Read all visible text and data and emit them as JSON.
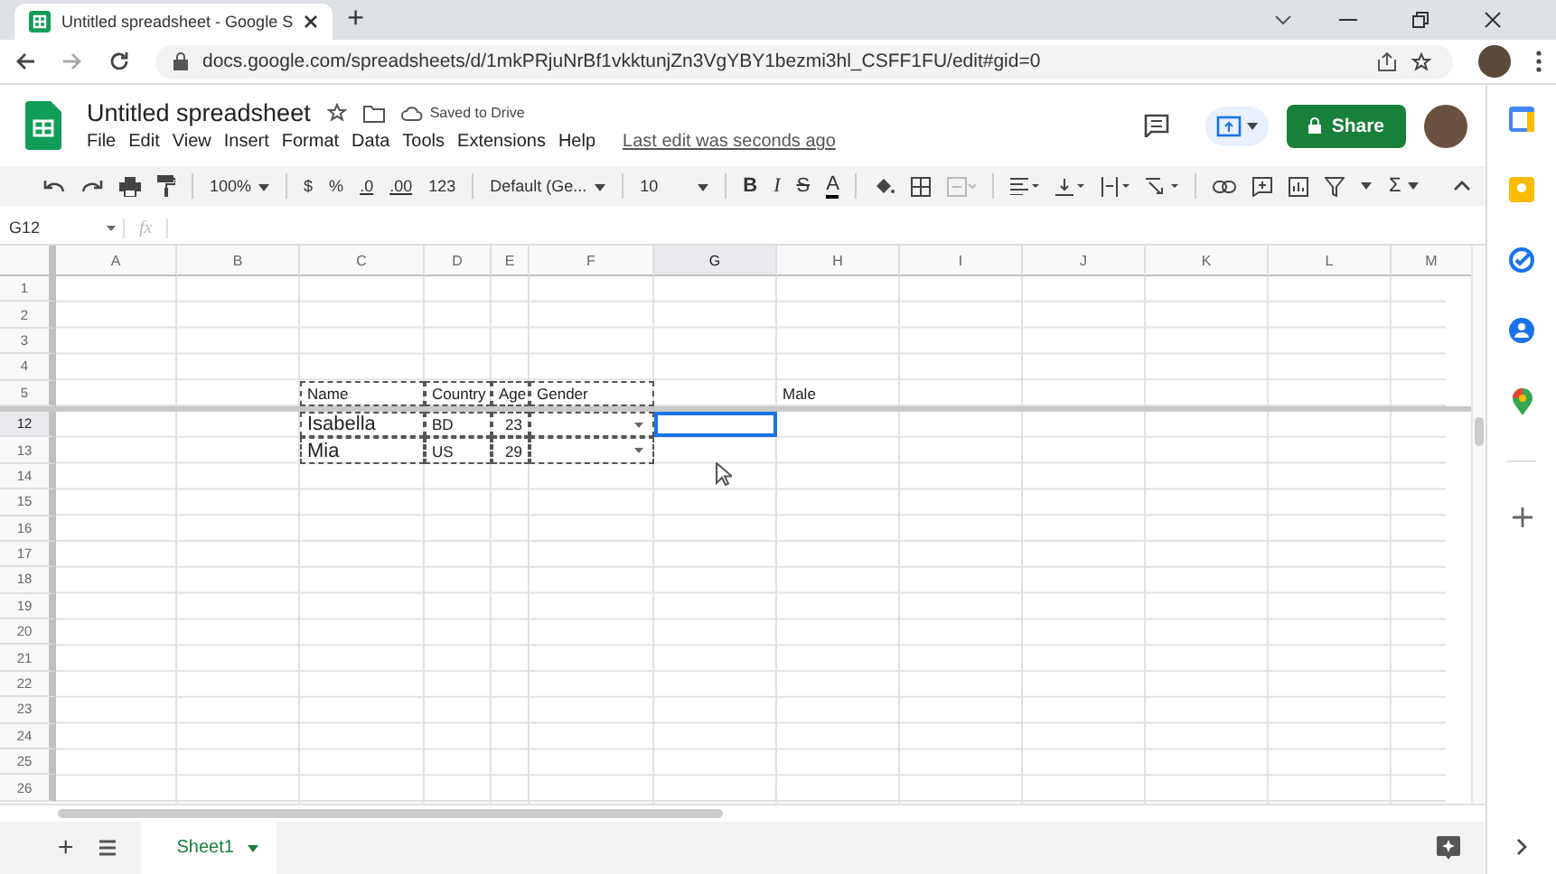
{
  "browser": {
    "tab_title": "Untitled spreadsheet - Google S",
    "new_tab": "+",
    "url": "docs.google.com/spreadsheets/d/1mkPRjuNrBf1vkktunjZn3VgYBY1bezmi3hl_CSFF1FU/edit#gid=0"
  },
  "document": {
    "title": "Untitled spreadsheet",
    "saved_status": "Saved to Drive",
    "menus": [
      "File",
      "Edit",
      "View",
      "Insert",
      "Format",
      "Data",
      "Tools",
      "Extensions",
      "Help"
    ],
    "last_edit": "Last edit was seconds ago",
    "share_button": "Share"
  },
  "toolbar": {
    "zoom": "100%",
    "currency": "$",
    "percent": "%",
    "decrease_decimal": ".0",
    "increase_decimal": ".00",
    "number_format": "123",
    "font": "Default (Ge...",
    "font_size": "10",
    "bold": "B",
    "italic": "I",
    "strikethrough": "S",
    "text_color": "A",
    "sum": "Σ"
  },
  "formula_bar": {
    "cell_ref": "G12",
    "fx": "fx"
  },
  "columns": [
    {
      "label": "A",
      "selected": false
    },
    {
      "label": "B",
      "selected": false
    },
    {
      "label": "C",
      "selected": false
    },
    {
      "label": "D",
      "selected": false
    },
    {
      "label": "E",
      "selected": false
    },
    {
      "label": "F",
      "selected": false
    },
    {
      "label": "G",
      "selected": true
    },
    {
      "label": "H",
      "selected": false
    },
    {
      "label": "I",
      "selected": false
    },
    {
      "label": "J",
      "selected": false
    },
    {
      "label": "K",
      "selected": false
    },
    {
      "label": "L",
      "selected": false
    },
    {
      "label": "M",
      "selected": false
    }
  ],
  "rows": [
    {
      "number": "1",
      "selected": false
    },
    {
      "number": "2",
      "selected": false
    },
    {
      "number": "3",
      "selected": false
    },
    {
      "number": "4",
      "selected": false
    },
    {
      "number": "5",
      "selected": false,
      "frozen_divider_below": true,
      "cells": [
        null,
        null,
        {
          "kind": "text",
          "text": "Name",
          "copied": true
        },
        {
          "kind": "text",
          "text": "Country",
          "copied": true
        },
        {
          "kind": "text",
          "text": "Age",
          "copied": true
        },
        {
          "kind": "text",
          "text": "Gender",
          "copied": true
        },
        null,
        {
          "kind": "text",
          "text": "Male",
          "copied": false
        }
      ]
    },
    {
      "number": "12",
      "selected": true,
      "cells": [
        null,
        null,
        {
          "kind": "large-text",
          "text": "Isabella",
          "copied": true
        },
        {
          "kind": "text",
          "text": "BD",
          "copied": true
        },
        {
          "kind": "number",
          "text": "23",
          "copied": true
        },
        {
          "kind": "dropdown",
          "copied": true
        },
        {
          "kind": "empty",
          "copied": false,
          "selected": true
        }
      ]
    },
    {
      "number": "13",
      "selected": false,
      "cells": [
        null,
        null,
        {
          "kind": "large-text",
          "text": "Mia",
          "copied": true
        },
        {
          "kind": "text",
          "text": "US",
          "copied": true
        },
        {
          "kind": "number",
          "text": "29",
          "copied": true
        },
        {
          "kind": "dropdown",
          "copied": true
        }
      ]
    },
    {
      "number": "14",
      "selected": false
    },
    {
      "number": "15",
      "selected": false
    },
    {
      "number": "16",
      "selected": false
    },
    {
      "number": "17",
      "selected": false
    },
    {
      "number": "18",
      "selected": false
    },
    {
      "number": "19",
      "selected": false
    },
    {
      "number": "20",
      "selected": false
    },
    {
      "number": "21",
      "selected": false
    },
    {
      "number": "22",
      "selected": false
    },
    {
      "number": "23",
      "selected": false
    },
    {
      "number": "24",
      "selected": false
    },
    {
      "number": "25",
      "selected": false
    },
    {
      "number": "26",
      "selected": false
    }
  ],
  "sheet_bar": {
    "add": "+",
    "sheets": [
      {
        "label": "Sheet1",
        "selected": true
      }
    ]
  }
}
